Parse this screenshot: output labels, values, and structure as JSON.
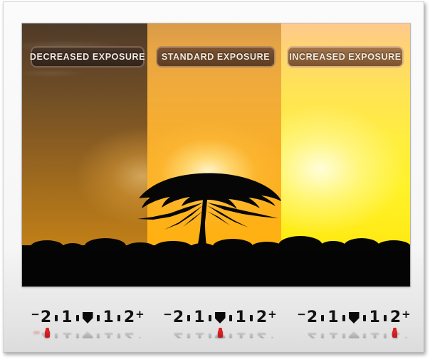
{
  "scene": {
    "subject": "acacia tree sunset silhouette",
    "panel_count": 3
  },
  "panels": [
    {
      "id": "decreased",
      "badge_label": "DECREASED EXPOSURE",
      "badge_fill": "#3c2b20",
      "badge_border": "#7d6350",
      "sky_top": "#4e3a28",
      "sky_bottom": "#c98516",
      "description": "underexposed"
    },
    {
      "id": "standard",
      "badge_label": "STANDARD EXPOSURE",
      "badge_fill": "#6b4629",
      "badge_border": "#b08a63",
      "sky_top": "#d99b4a",
      "sky_bottom": "#ffb40a",
      "description": "correctly exposed"
    },
    {
      "id": "increased",
      "badge_label": "INCREASED EXPOSURE",
      "badge_fill": "#8d6139",
      "badge_border": "#d8b286",
      "sky_top": "#ffc98e",
      "sky_bottom": "#ffe000",
      "description": "overexposed"
    }
  ],
  "meters": {
    "scale_ticks": [
      "−",
      "2",
      "·",
      "1",
      "·",
      "▼",
      "·",
      "1",
      "·",
      "2",
      "+"
    ],
    "minus_sign": "−",
    "plus_sign": "+",
    "label_two_left": "2",
    "label_one_left": "1",
    "center_marker": "▼",
    "label_one_right": "1",
    "label_two_right": "2",
    "indicator_color": "#d81f23",
    "items": [
      {
        "id": "decreased",
        "value": "-2",
        "indicator_position_pct": 16
      },
      {
        "id": "standard",
        "value": "0",
        "indicator_position_pct": 50
      },
      {
        "id": "increased",
        "value": "+2",
        "indicator_position_pct": 84
      }
    ]
  },
  "frame": {
    "background": "#f4f4f4",
    "border_color": "#b9b9b9"
  }
}
